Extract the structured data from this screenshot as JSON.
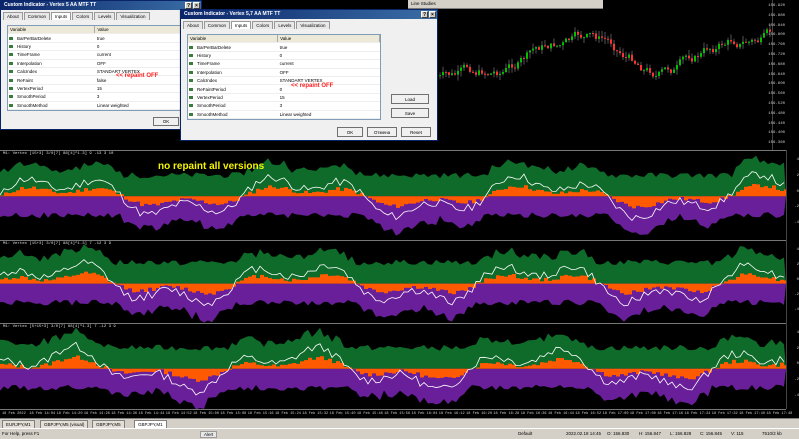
{
  "top_toolbar": {
    "title": "Line Studies"
  },
  "main_price_axis": [
    "156.920",
    "156.880",
    "156.840",
    "156.800",
    "156.760",
    "156.720",
    "156.680",
    "156.640",
    "156.600",
    "156.560",
    "156.520",
    "156.480",
    "156.440",
    "156.400",
    "156.360"
  ],
  "dialog1": {
    "title": "Custom Indicator - Vertex 5 AA MTF TT",
    "tabs": [
      "About",
      "Common",
      "Inputs",
      "Colors",
      "Levels",
      "Visualization"
    ],
    "active_tab": "Inputs",
    "header": [
      "Variable",
      "Value"
    ],
    "rows": [
      [
        "BarPerBarDelete",
        "true"
      ],
      [
        "History",
        "0"
      ],
      [
        "TimeFrame",
        "current"
      ],
      [
        "Interpolation",
        "OFF"
      ],
      [
        "CalcIndex",
        "STANDART VERTEX"
      ],
      [
        "ReFaint",
        "false"
      ],
      [
        "VertexPeriod",
        "15"
      ],
      [
        "SmoothPeriod",
        "3"
      ],
      [
        "SmoothMethod",
        "Linear weighted"
      ]
    ],
    "repaint_note": "<< repaint OFF",
    "ok": "OK"
  },
  "dialog2": {
    "title": "Custom Indicator - Vertex 5,7 AA MTF TT",
    "tabs": [
      "About",
      "Common",
      "Inputs",
      "Colors",
      "Levels",
      "Visualization"
    ],
    "active_tab": "Inputs",
    "header": [
      "Variable",
      "Value"
    ],
    "rows": [
      [
        "BarPerBarDelete",
        "true"
      ],
      [
        "History",
        "0"
      ],
      [
        "TimeFrame",
        "current"
      ],
      [
        "Interpolation",
        "OFF"
      ],
      [
        "CalcIndex",
        "STANDART VERTEX"
      ],
      [
        "ReFaintPeriod",
        "0"
      ],
      [
        "VertexPeriod",
        "15"
      ],
      [
        "SmoothPeriod",
        "3"
      ],
      [
        "SmoothMethod",
        "Linear weighted"
      ]
    ],
    "repaint_note": "<< repaint OFF",
    "load": "Load",
    "save": "Save",
    "ok": "OK",
    "cancel": "Отмена",
    "reset": "Reset"
  },
  "annotation": "no repaint  all  versions",
  "subwindows": [
    {
      "title": "M1: Vertex [15+3] 3/0[7] 88[4]^1.3]  9 -13 3 10",
      "axis": [
        "4",
        "2",
        "0",
        "-2",
        "-4"
      ]
    },
    {
      "title": "M1: Vertex [15+3] 3/0[7] 88[4]^1.3]  7 -12 3 9",
      "axis": [
        "4",
        "2",
        "0",
        "-2",
        "-4"
      ]
    },
    {
      "title": "M1: Vertex [5+15+3] 3/0[7] 88[4]^1.3]  7 -12 3 9",
      "axis": [
        "4",
        "2",
        "0",
        "-2",
        "-4"
      ]
    }
  ],
  "time_labels": [
    "18 Feb 2022",
    "18 Feb 14:04",
    "18 Feb 14:20",
    "18 Feb 14:28",
    "18 Feb 14:36",
    "18 Feb 14:44",
    "18 Feb 14:52",
    "18 Feb 15:00",
    "18 Feb 15:08",
    "18 Feb 15:16",
    "18 Feb 15:24",
    "18 Feb 15:32",
    "18 Feb 15:40",
    "18 Feb 15:48",
    "18 Feb 15:56",
    "18 Feb 16:04",
    "18 Feb 16:12",
    "18 Feb 16:20",
    "18 Feb 16:28",
    "18 Feb 16:36",
    "18 Feb 16:44",
    "18 Feb 16:52",
    "18 Feb 17:00",
    "18 Feb 17:08",
    "18 Feb 17:16",
    "18 Feb 17:24",
    "18 Feb 17:32",
    "18 Feb 17:40",
    "18 Feb 17:48"
  ],
  "symbol_tabs": [
    "EURJPY,M1",
    "GBPJPY,M5 (visual)",
    "GBPJPY,M5",
    "GBPJPY,M1"
  ],
  "active_symbol_tab": "GBPJPY,M1",
  "status": {
    "help": "For Help, press F1",
    "alert": "Alert",
    "profile": "Default",
    "datetime": "2022.02.18 14:45",
    "open": "O: 156.830",
    "high": "H: 156.847",
    "low": "L: 156.828",
    "close": "C: 156.845",
    "volume": "V: 115",
    "traffic": "7510/2 kb"
  },
  "colors": {
    "green": "#0f6b2a",
    "orange": "#ff5a00",
    "purple": "#6a1f9a",
    "white": "#ffffff",
    "annotation": "#f5f500",
    "repaint": "#ff2020"
  }
}
